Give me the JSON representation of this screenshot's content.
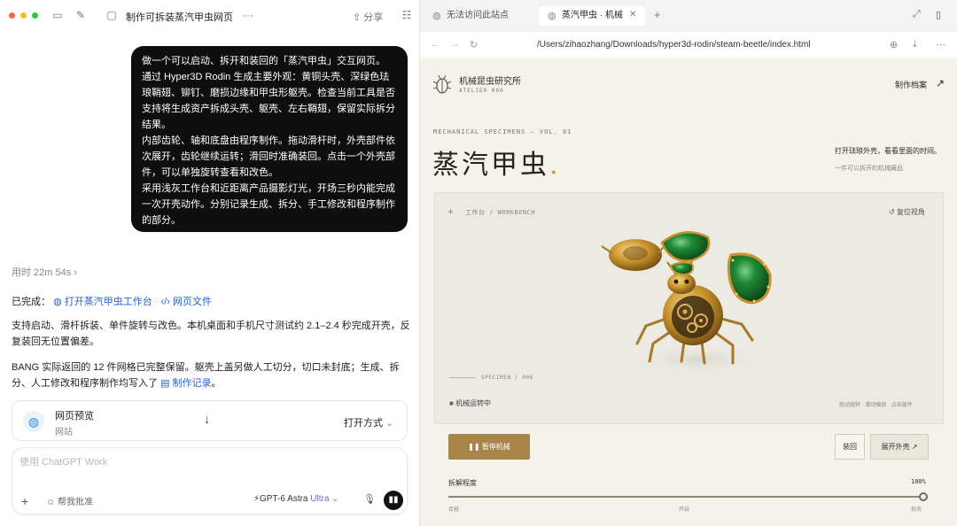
{
  "chat": {
    "title": "制作可拆装蒸汽甲虫网页",
    "more": "···",
    "share": "分享",
    "user_message": [
      "做一个可以启动、拆开和装回的「蒸汽甲虫」交互网页。",
      "通过 Hyper3D Rodin 生成主要外观：黄铜头壳、深绿色珐琅鞘翅、铆钉、磨损边缘和甲虫形躯壳。检查当前工具是否支持将生成资产拆成头壳、躯壳、左右鞘翅，保留实际拆分结果。",
      "内部齿轮、轴和底盘由程序制作。拖动滑杆时，外壳部件依次展开，齿轮继续运转；滑回时准确装回。点击一个外壳部件，可以单独旋转查看和改色。",
      "采用浅灰工作台和近距离产品摄影灯光，开场三秒内能完成一次开壳动作。分别记录生成、拆分、手工修改和程序制作的部分。"
    ],
    "elapsed": "用时 22m 54s",
    "done_label": "已完成：",
    "done_link1": "打开蒸汽甲虫工作台",
    "done_link2": "网页文件",
    "para1": "支持启动、滑杆拆装、单件旋转与改色。本机桌面和手机尺寸测试约 2.1–2.4 秒完成开壳，反复装回无位置偏差。",
    "para2_pre": "BANG 实际返回的 12 件网格已完整保留。躯壳上盖另做人工切分，切口未封底；生成、拆分、人工修改和程序制作均写入了",
    "para2_link": "制作记录",
    "para2_post": "。",
    "preview_card": {
      "title": "网页预览",
      "subtitle": "网站",
      "open_with": "打开方式"
    },
    "composer": {
      "placeholder": "使用 ChatGPT Work",
      "review": "帮我批准",
      "model": "GPT-6 Astra",
      "model_tier": "Ultra"
    }
  },
  "browser": {
    "tab1": "无法访问此站点",
    "tab2": "蒸汽甲虫 · 机械",
    "url": "/Users/zihaozhang/Downloads/hyper3d-rodin/steam-beetle/index.html"
  },
  "site": {
    "brand": "机械昆虫研究所",
    "atelier": "ATELIER 006",
    "archive": "制作档案",
    "kicker": "MECHANICAL SPECIMENS — VOL. 01",
    "hero_title": "蒸汽甲虫",
    "hero_dot": ".",
    "tagline": "打开琺琅外壳，看看里面的时间。",
    "tagline_sub": "一件可以拆开的机械藏品",
    "stage_label": "工作台 / WORKBENCH",
    "reset_view": "复位视角",
    "specimen": "SPECIMEN / 006",
    "status": "机械运转中",
    "hints": "拖动旋转 · 滚动缩放 · 点击部件",
    "pause": "暂停机械",
    "assemble": "装回",
    "explode": "展开外壳",
    "slider_label": "拆解程度",
    "slider_value_text": "100%",
    "slider_value": 1.0,
    "scale_left": "合拢",
    "scale_mid": "开启",
    "scale_right": "拆壳",
    "colors": {
      "enamel": "#1f7a2e",
      "brass": "#c8922c",
      "pause_button": "#a8864a",
      "page_bg": "#f4f2ea"
    }
  }
}
